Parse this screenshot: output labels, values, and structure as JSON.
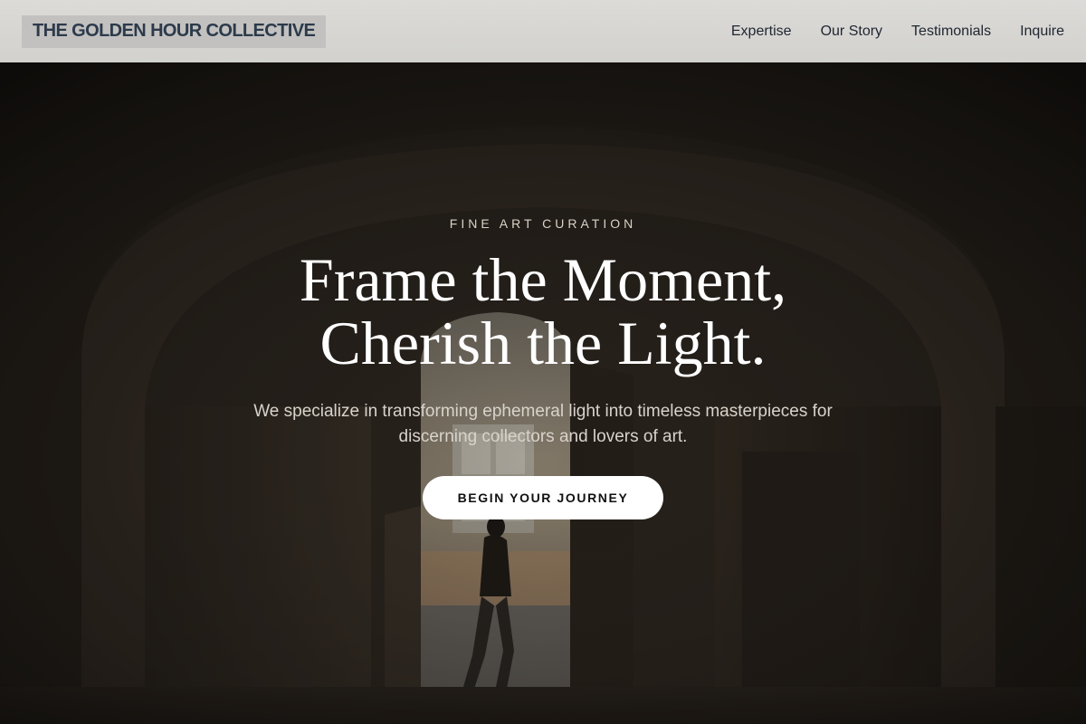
{
  "header": {
    "logo": "THE GOLDEN HOUR COLLECTIVE",
    "nav": [
      {
        "label": "Expertise"
      },
      {
        "label": "Our Story"
      },
      {
        "label": "Testimonials"
      },
      {
        "label": "Inquire"
      }
    ]
  },
  "hero": {
    "eyebrow": "FINE ART CURATION",
    "headline_line1": "Frame the Moment,",
    "headline_line2": "Cherish the Light.",
    "subtext": "We specialize in transforming ephemeral light into timeless masterpieces for discerning collectors and lovers of art.",
    "cta_label": "BEGIN YOUR JOURNEY",
    "background_photo": "dark archway corridor with a person walking toward an open doorway"
  },
  "colors": {
    "header_bg": "#d6d5d2",
    "logo_text": "#2c3a4b",
    "cta_bg": "#ffffff",
    "cta_text": "#111111"
  }
}
